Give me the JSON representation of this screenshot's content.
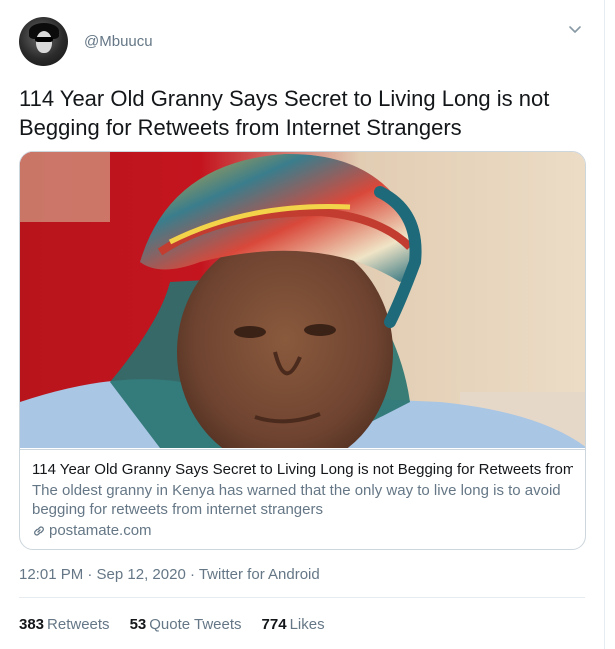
{
  "tweet": {
    "handle": "@Mbuucu",
    "text": "114 Year Old Granny Says Secret to Living Long is not Begging for Retweets from Internet Strangers",
    "timestamp": "12:01 PM · Sep 12, 2020 · Twitter for Android"
  },
  "card": {
    "title": "114 Year Old Granny Says Secret to Living Long is not Begging for Retweets from...",
    "description": "The oldest granny in Kenya has warned that the only way to live long is to avoid begging for retweets from internet strangers",
    "domain": "postamate.com"
  },
  "stats": {
    "retweets_count": "383",
    "retweets_label": "Retweets",
    "quotes_count": "53",
    "quotes_label": "Quote Tweets",
    "likes_count": "774",
    "likes_label": "Likes"
  },
  "icons": {
    "menu": "chevron-down-icon",
    "link": "link-icon"
  },
  "colors": {
    "text": "#14171a",
    "secondary": "#657786",
    "border": "#ccd6dd",
    "accent": "#1da1f2"
  }
}
